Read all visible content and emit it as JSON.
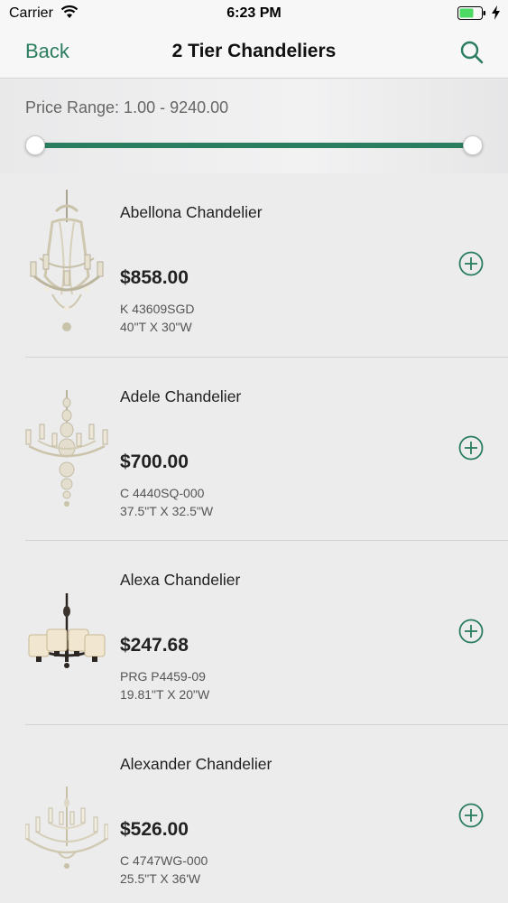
{
  "status": {
    "carrier": "Carrier",
    "time": "6:23 PM"
  },
  "nav": {
    "back_label": "Back",
    "title": "2 Tier Chandeliers",
    "search_icon": "search-icon"
  },
  "filter": {
    "price_range_label": "Price Range: 1.00 - 9240.00",
    "min": 1.0,
    "max": 9240.0
  },
  "accent_color": "#2a7d5e",
  "products": [
    {
      "name": "Abellona Chandelier",
      "price": "$858.00",
      "sku": "K 43609SGD",
      "dims": "40\"T X 30\"W"
    },
    {
      "name": "Adele Chandelier",
      "price": "$700.00",
      "sku": "C 4440SQ-000",
      "dims": "37.5\"T X 32.5\"W"
    },
    {
      "name": "Alexa Chandelier",
      "price": "$247.68",
      "sku": "PRG P4459-09",
      "dims": "19.81\"T X 20\"W"
    },
    {
      "name": "Alexander Chandelier",
      "price": "$526.00",
      "sku": "C 4747WG-000",
      "dims": "25.5\"T X 36'W"
    }
  ]
}
